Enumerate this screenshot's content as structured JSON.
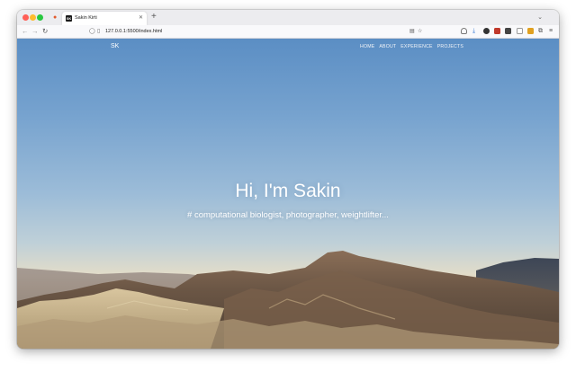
{
  "browser": {
    "tab": {
      "favicon_text": "SK",
      "title": "Sakin Kirti"
    },
    "url": "127.0.0.1:5500/index.html"
  },
  "site": {
    "logo": "SK",
    "nav": [
      "HOME",
      "ABOUT",
      "EXPERIENCE",
      "PROJECTS"
    ],
    "hero_title": "Hi, I'm Sakin",
    "hero_subtitle": "# computational biologist, photographer, weightlifter..."
  },
  "colors": {
    "sky_top": "#5b8ec4",
    "horizon": "#e8d5b8",
    "mountain_dark": "#6b5a4a",
    "mountain_light": "#c9b48f"
  }
}
